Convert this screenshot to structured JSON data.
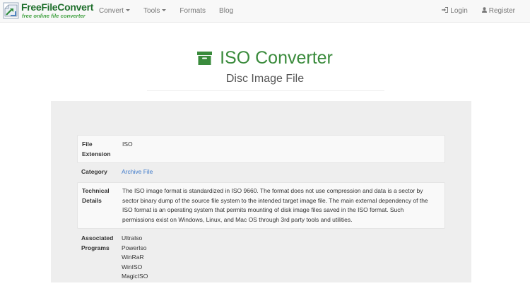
{
  "brand": {
    "name": "FreeFileConvert",
    "tagline": "free online file converter"
  },
  "nav": {
    "convert": "Convert",
    "tools": "Tools",
    "formats": "Formats",
    "blog": "Blog",
    "login": "Login",
    "register": "Register"
  },
  "header": {
    "title": "ISO Converter",
    "subtitle": "Disc Image File"
  },
  "details": {
    "extension_label_1": "File",
    "extension_label_2": "Extension",
    "extension_value": "ISO",
    "category_label": "Category",
    "category_value": "Archive File",
    "technical_label_1": "Technical",
    "technical_label_2": "Details",
    "technical_lines": [
      "The ISO image format is standardized in ISO 9660. The format does not use compression and data is a sector by",
      "sector binary dump of the source file system to the intended target image file. The main external dependency of the",
      "ISO format is an operating system that permits mounting of disk image files saved in the ISO format. Such",
      "permissions exist on Windows, Linux, and Mac OS through 3rd party tools and utilities."
    ],
    "programs_label_1": "Associated",
    "programs_label_2": "Programs",
    "programs": [
      "UltraIso",
      "PowerIso",
      "WinRaR",
      "WinISO",
      "MagicISO"
    ]
  },
  "colors": {
    "brand_green": "#1f6f2c",
    "title_green": "#3a8b3c",
    "link_blue": "#3c78c9",
    "navbar_bg": "#f8f8f8",
    "panel_bg": "#eeeeee"
  },
  "icons": {
    "logo": "freefileconvert-logo",
    "title": "archive-box-icon",
    "login": "sign-in-icon",
    "register": "user-icon"
  }
}
